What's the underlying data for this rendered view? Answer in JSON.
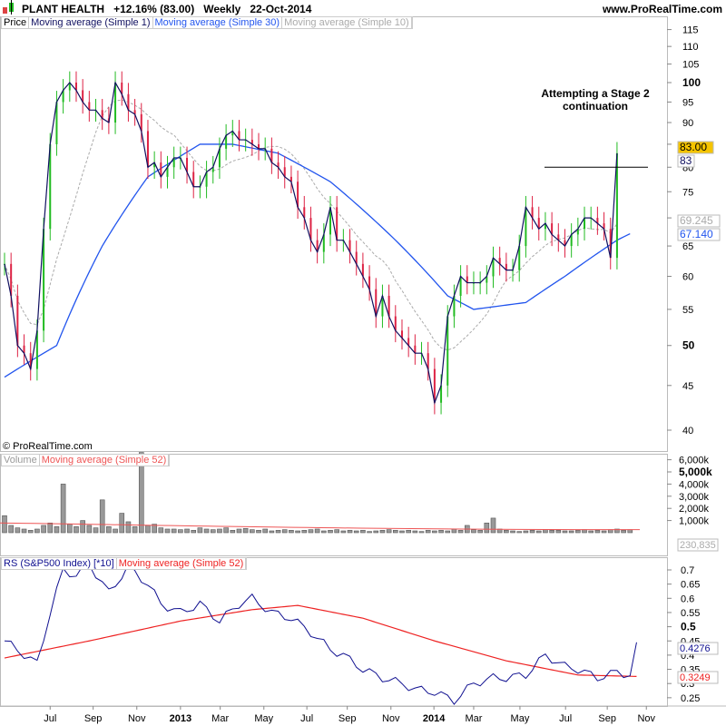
{
  "header": {
    "title": "PLANT HEALTH",
    "change": "+12.16% (83.00)",
    "period": "Weekly",
    "date": "22-Oct-2014",
    "site": "www.ProRealTime.com"
  },
  "price_legend": [
    "Price",
    "Moving average (Simple 1)",
    "Moving average (Simple 30)",
    "Moving average (Simple 10)"
  ],
  "volume_legend": [
    "Volume",
    "Moving average (Simple 52)"
  ],
  "rs_legend": [
    "RS (S&P500 Index) [*10]",
    "Moving average (Simple 52)"
  ],
  "copyright": "© ProRealTime.com",
  "annotation": "Attempting a Stage 2\ncontinuation",
  "colors": {
    "up": "#22bb22",
    "down": "#dd2244",
    "ma1": "#101060",
    "ma30": "#2255ee",
    "ma10": "#aaaaaa",
    "rs": "#101090",
    "rsma": "#ee2222",
    "last": "#f5c400"
  },
  "chart_data": [
    {
      "type": "candlestick",
      "title": "PLANT HEALTH weekly",
      "yscale": "log",
      "ylim": [
        38,
        117
      ],
      "yticks": [
        "115",
        "110",
        "105",
        "100",
        "95",
        "90",
        "85",
        "80",
        "75",
        "70",
        "65",
        "60",
        "55",
        "50",
        "45",
        "40"
      ],
      "closes": [
        62,
        57,
        50,
        49,
        47,
        52,
        68,
        85,
        95,
        98,
        100,
        98,
        95,
        93,
        93,
        91,
        90,
        100,
        97,
        93,
        92,
        88,
        80,
        81,
        78,
        80,
        82,
        82,
        79,
        76,
        76,
        79,
        80,
        84,
        87,
        88,
        86,
        86,
        85,
        84,
        84,
        81,
        80,
        78,
        77,
        72,
        70,
        66,
        64,
        67,
        72,
        66,
        66,
        64,
        62,
        60,
        58,
        54,
        57,
        54,
        52,
        51,
        50,
        49,
        49,
        47,
        43,
        45,
        54,
        57,
        60,
        59,
        59,
        59,
        60,
        63,
        62,
        61,
        61,
        65,
        72,
        70,
        68,
        69,
        67,
        66,
        65,
        67,
        68,
        70,
        70,
        69,
        68,
        63,
        83
      ],
      "ma30": [
        {
          "w": 0,
          "v": 46
        },
        {
          "w": 8,
          "v": 50
        },
        {
          "w": 15,
          "v": 65
        },
        {
          "w": 22,
          "v": 78
        },
        {
          "w": 30,
          "v": 85
        },
        {
          "w": 35,
          "v": 85
        },
        {
          "w": 42,
          "v": 83
        },
        {
          "w": 50,
          "v": 77
        },
        {
          "w": 60,
          "v": 66
        },
        {
          "w": 68,
          "v": 57
        },
        {
          "w": 72,
          "v": 55
        },
        {
          "w": 80,
          "v": 56
        },
        {
          "w": 86,
          "v": 60
        },
        {
          "w": 94,
          "v": 66
        },
        {
          "w": 96,
          "v": 67.14
        }
      ],
      "last_labels": [
        "83.00",
        "83",
        "69.245",
        "67.140"
      ],
      "resistance": 80
    },
    {
      "type": "bar",
      "title": "Volume",
      "yticks": [
        "6,000k",
        "5,000k",
        "4,000k",
        "3,000k",
        "2,000k",
        "1,000k"
      ],
      "ylim": [
        0,
        6500
      ],
      "last_label": "230,835",
      "values": [
        1400,
        600,
        400,
        300,
        200,
        300,
        600,
        800,
        500,
        4000,
        700,
        500,
        1000,
        600,
        400,
        2700,
        500,
        300,
        1600,
        900,
        500,
        6600,
        600,
        700,
        400,
        300,
        300,
        250,
        300,
        200,
        400,
        300,
        250,
        300,
        400,
        200,
        300,
        350,
        250,
        200,
        300,
        150,
        200,
        250,
        200,
        150,
        200,
        250,
        300,
        150,
        200,
        250,
        150,
        200,
        150,
        200,
        100,
        150,
        200,
        250,
        200,
        150,
        200,
        150,
        100,
        200,
        150,
        200,
        150,
        300,
        200,
        600,
        250,
        200,
        800,
        1200,
        300,
        200,
        150,
        100,
        150,
        200,
        150,
        250,
        200,
        200,
        150,
        150,
        200,
        250,
        150,
        200,
        150,
        250,
        300,
        200,
        250
      ],
      "ma52_start": 800,
      "ma52_end": 250
    },
    {
      "type": "line",
      "title": "RS (S&P500 Index) [*10]",
      "ylim": [
        0.22,
        0.73
      ],
      "yticks": [
        "0.7",
        "0.65",
        "0.6",
        "0.55",
        "0.5",
        "0.45",
        "0.4",
        "0.35",
        "0.3",
        "0.25"
      ],
      "last_labels": [
        "0.4276",
        "0.3249"
      ],
      "rs": [
        {
          "w": 0,
          "v": 0.45
        },
        {
          "w": 5,
          "v": 0.37
        },
        {
          "w": 7,
          "v": 0.55
        },
        {
          "w": 9,
          "v": 0.7
        },
        {
          "w": 11,
          "v": 0.68
        },
        {
          "w": 13,
          "v": 0.72
        },
        {
          "w": 16,
          "v": 0.62
        },
        {
          "w": 19,
          "v": 0.71
        },
        {
          "w": 22,
          "v": 0.65
        },
        {
          "w": 24,
          "v": 0.58
        },
        {
          "w": 27,
          "v": 0.55
        },
        {
          "w": 30,
          "v": 0.58
        },
        {
          "w": 33,
          "v": 0.52
        },
        {
          "w": 36,
          "v": 0.58
        },
        {
          "w": 38,
          "v": 0.6
        },
        {
          "w": 41,
          "v": 0.55
        },
        {
          "w": 44,
          "v": 0.53
        },
        {
          "w": 47,
          "v": 0.48
        },
        {
          "w": 50,
          "v": 0.42
        },
        {
          "w": 52,
          "v": 0.4
        },
        {
          "w": 55,
          "v": 0.35
        },
        {
          "w": 58,
          "v": 0.32
        },
        {
          "w": 61,
          "v": 0.3
        },
        {
          "w": 63,
          "v": 0.28
        },
        {
          "w": 66,
          "v": 0.27
        },
        {
          "w": 69,
          "v": 0.24
        },
        {
          "w": 72,
          "v": 0.3
        },
        {
          "w": 75,
          "v": 0.32
        },
        {
          "w": 77,
          "v": 0.32
        },
        {
          "w": 80,
          "v": 0.33
        },
        {
          "w": 83,
          "v": 0.4
        },
        {
          "w": 86,
          "v": 0.36
        },
        {
          "w": 88,
          "v": 0.35
        },
        {
          "w": 91,
          "v": 0.32
        },
        {
          "w": 94,
          "v": 0.34
        },
        {
          "w": 96,
          "v": 0.33
        },
        {
          "w": 97,
          "v": 0.43
        }
      ],
      "ma52": [
        {
          "w": 0,
          "v": 0.39
        },
        {
          "w": 13,
          "v": 0.45
        },
        {
          "w": 27,
          "v": 0.52
        },
        {
          "w": 38,
          "v": 0.56
        },
        {
          "w": 45,
          "v": 0.575
        },
        {
          "w": 55,
          "v": 0.53
        },
        {
          "w": 66,
          "v": 0.45
        },
        {
          "w": 77,
          "v": 0.38
        },
        {
          "w": 88,
          "v": 0.33
        },
        {
          "w": 97,
          "v": 0.325
        }
      ]
    }
  ],
  "xaxis": [
    {
      "l": "Jul",
      "w": 7
    },
    {
      "l": "Sep",
      "w": 13.6
    },
    {
      "l": "Nov",
      "w": 20.3
    },
    {
      "l": "2013",
      "w": 27
    },
    {
      "l": "Mar",
      "w": 33.1
    },
    {
      "l": "May",
      "w": 39.8
    },
    {
      "l": "Jul",
      "w": 46.4
    },
    {
      "l": "Sep",
      "w": 52.6
    },
    {
      "l": "Nov",
      "w": 59.3
    },
    {
      "l": "2014",
      "w": 65.9
    },
    {
      "l": "Mar",
      "w": 72
    },
    {
      "l": "May",
      "w": 79.1
    },
    {
      "l": "Jul",
      "w": 86.1
    },
    {
      "l": "Sep",
      "w": 92.5
    },
    {
      "l": "Nov",
      "w": 98.5
    }
  ]
}
